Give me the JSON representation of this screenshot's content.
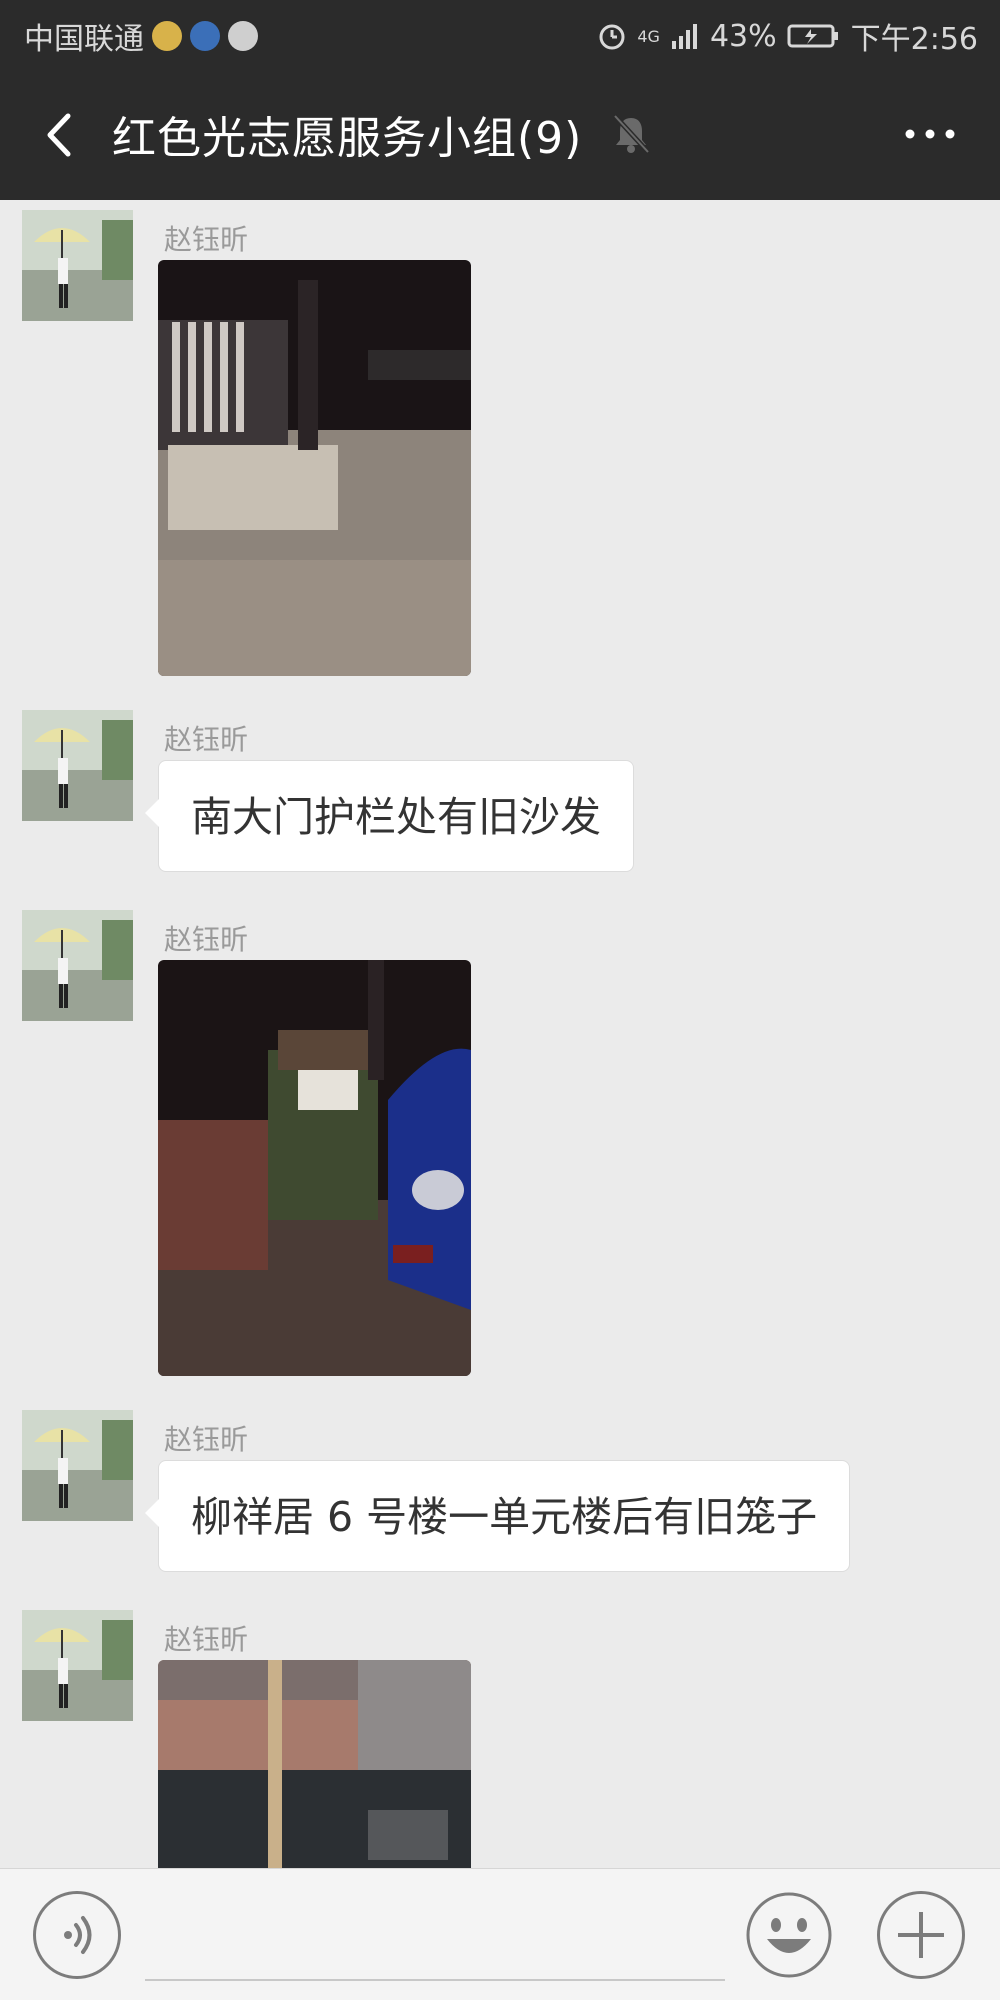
{
  "status_bar": {
    "carrier": "中国联通",
    "network": "4G",
    "battery": "43%",
    "time": "下午2:56"
  },
  "nav": {
    "title": "红色光志愿服务小组(9)"
  },
  "messages": [
    {
      "sender": "赵钰昕",
      "type": "image",
      "photo": "night-railing-photo"
    },
    {
      "sender": "赵钰昕",
      "type": "text",
      "text": "南大门护栏处有旧沙发"
    },
    {
      "sender": "赵钰昕",
      "type": "image",
      "photo": "night-sofa-car-photo"
    },
    {
      "sender": "赵钰昕",
      "type": "text",
      "text": "柳祥居 6 号楼一单元楼后有旧笼子"
    },
    {
      "sender": "赵钰昕",
      "type": "image",
      "photo": "building-wall-photo"
    }
  ],
  "colors": {
    "header_bg": "#2b2b2b",
    "chat_bg": "#ebebeb",
    "bubble_bg": "#ffffff",
    "input_bg": "#f4f4f4"
  }
}
